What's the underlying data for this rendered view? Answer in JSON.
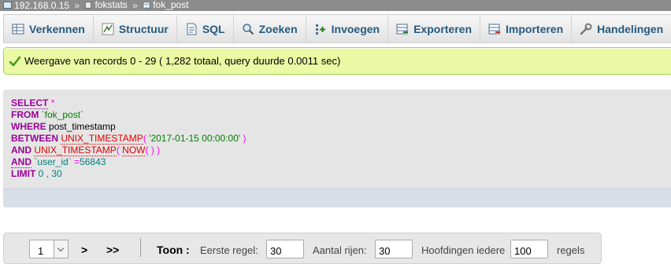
{
  "breadcrumb": {
    "server": "192.168.0.15",
    "database": "fokstats",
    "table": "fok_post",
    "separator": "»"
  },
  "tabs": [
    {
      "label": "Verkennen",
      "icon": "browse-icon"
    },
    {
      "label": "Structuur",
      "icon": "structure-icon"
    },
    {
      "label": "SQL",
      "icon": "sql-icon"
    },
    {
      "label": "Zoeken",
      "icon": "search-icon"
    },
    {
      "label": "Invoegen",
      "icon": "insert-icon"
    },
    {
      "label": "Exporteren",
      "icon": "export-icon"
    },
    {
      "label": "Importeren",
      "icon": "import-icon"
    },
    {
      "label": "Handelingen",
      "icon": "operations-icon"
    }
  ],
  "success": {
    "message": "Weergave van records 0 - 29 ( 1,282 totaal, query duurde 0.0011 sec)"
  },
  "sql": {
    "select": "SELECT",
    "star": "*",
    "from": "FROM",
    "table": "`fok_post`",
    "where": "WHERE",
    "column": "post_timestamp",
    "between": "BETWEEN",
    "unix_ts": "UNIX_TIMESTAMP",
    "paren_open": "(",
    "paren_close": ")",
    "date_str": "'2017-01-15 00:00:00'",
    "and": "AND",
    "now": "NOW",
    "now_parens": "( ) )",
    "user_col": "`user_id`",
    "eq": "=",
    "user_val": "56843",
    "limit": "LIMIT",
    "limit_vals": "0 , 30"
  },
  "nav": {
    "page": "1",
    "next": ">",
    "last": ">>",
    "show_label": "Toon :",
    "first_row_label": "Eerste regel:",
    "first_row_value": "30",
    "rows_label": "Aantal rijen:",
    "rows_value": "30",
    "headers_label": "Hoofdingen iedere",
    "headers_value": "100",
    "rows_suffix": "regels"
  },
  "colors": {
    "tab_text": "#235a81",
    "success_bg": "#ebf8a4",
    "keyword": "#990099",
    "function": "#e10000",
    "string": "#008000",
    "number": "#008080"
  }
}
